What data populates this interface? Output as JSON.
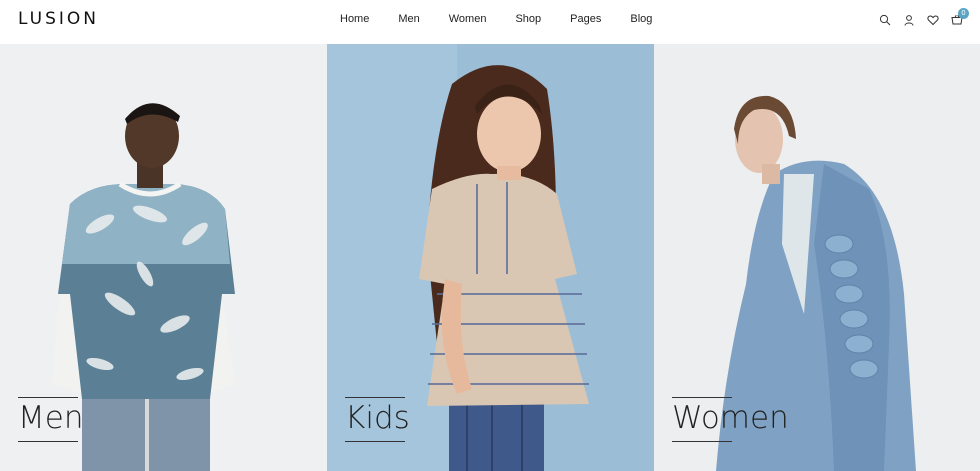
{
  "header": {
    "logo": "LUSION",
    "nav": [
      "Home",
      "Men",
      "Women",
      "Shop",
      "Pages",
      "Blog"
    ],
    "cart_count": "0",
    "icons": [
      "search-icon",
      "user-icon",
      "heart-icon",
      "cart-icon"
    ]
  },
  "panels": [
    {
      "label": "Men",
      "background": "#eef0f1"
    },
    {
      "label": "Kids",
      "background": "#a5c5dc"
    },
    {
      "label": "Women",
      "background": "#eceeef"
    }
  ],
  "colors": {
    "accent": "#5aa5c5",
    "text": "#1a1a1a"
  }
}
